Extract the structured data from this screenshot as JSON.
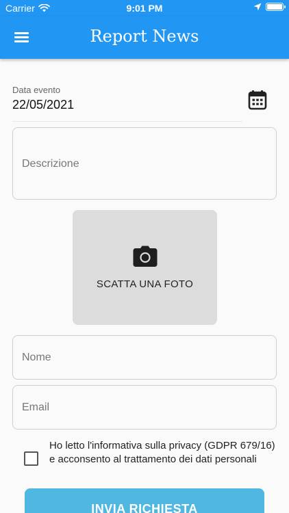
{
  "status_bar": {
    "carrier": "Carrier",
    "time": "9:01 PM",
    "icons": [
      "wifi-icon",
      "location-arrow-icon",
      "battery-icon"
    ]
  },
  "app_bar": {
    "title": "Report News",
    "menu_icon": "menu-icon",
    "color": "#2196f3"
  },
  "form": {
    "date": {
      "label": "Data evento",
      "value": "22/05/2021",
      "icon": "calendar-icon"
    },
    "description": {
      "placeholder": "Descrizione",
      "value": ""
    },
    "photo": {
      "label": "SCATTA UNA FOTO",
      "icon": "camera-icon"
    },
    "name": {
      "placeholder": "Nome",
      "value": ""
    },
    "email": {
      "placeholder": "Email",
      "value": ""
    },
    "consent": {
      "text": "Ho letto l'informativa sulla privacy (GDPR 679/16) e acconsento al trattamento dei dati personali",
      "checked": false
    },
    "submit": {
      "label": "INVIA RICHIESTA",
      "color": "#4fb7e0"
    }
  }
}
